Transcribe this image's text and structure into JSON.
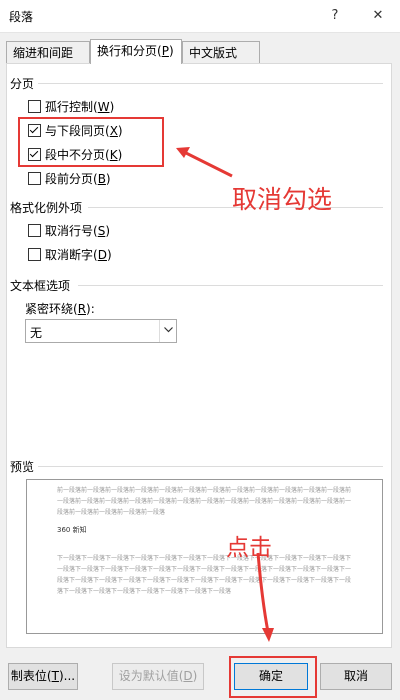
{
  "window": {
    "title": "段落",
    "help": "?",
    "close": "✕"
  },
  "tabs": [
    {
      "label": "缩进和间距(I)",
      "hotkey": "I",
      "prefix": "缩进和间距(",
      "suffix": ")"
    },
    {
      "label": "换行和分页(P)",
      "prefix": "换行和分页(",
      "hotkey": "P",
      "suffix": ")"
    },
    {
      "label": "中文版式(H)",
      "prefix": "中文版式(",
      "hotkey": "H",
      "suffix": ")"
    }
  ],
  "pagination": {
    "title": "分页",
    "items": [
      {
        "text": "孤行控制(",
        "hotkey": "W",
        "end": ")",
        "checked": false
      },
      {
        "text": "与下段同页(",
        "hotkey": "X",
        "end": ")",
        "checked": true
      },
      {
        "text": "段中不分页(",
        "hotkey": "K",
        "end": ")",
        "checked": true
      },
      {
        "text": "段前分页(",
        "hotkey": "B",
        "end": ")",
        "checked": false
      }
    ]
  },
  "exceptions": {
    "title": "格式化例外项",
    "items": [
      {
        "text": "取消行号(",
        "hotkey": "S",
        "end": ")",
        "checked": false
      },
      {
        "text": "取消断字(",
        "hotkey": "D",
        "end": ")",
        "checked": false
      }
    ]
  },
  "textbox": {
    "title": "文本框选项",
    "wrap_label_pre": "紧密环绕(",
    "wrap_hotkey": "R",
    "wrap_label_post": "):",
    "wrap_value": "无"
  },
  "preview": {
    "title": "预览",
    "prev_text": "前一段落前一段落前一段落前一段落前一段落前一段落前一段落前一段落前一段落前一段落前一段落前一段落前一段落前一段落前一段落前一段落前一段落前一段落前一段落前一段落前一段落前一段落前一段落前一段落前一段落前一段落前一段落前一段落前一段落",
    "sample": "360 新知",
    "next_text": "下一段落下一段落下一段落下一段落下一段落下一段落下一段落下一段落下一段落下一段落下一段落下一段落下一段落下一段落下一段落下一段落下一段落下一段落下一段落下一段落下一段落下一段落下一段落下一段落下一段落下一段落下一段落下一段落下一段落下一段落下一段落下一段落下一段落下一段落下一段落下一段落下一段落下一段落下一段落下一段落下一段落下一段落下一段落下一段落"
  },
  "buttons": {
    "tabs_pre": "制表位(",
    "tabs_hotkey": "T",
    "tabs_post": ")...",
    "default_pre": "设为默认值(",
    "default_hotkey": "D",
    "default_post": ")",
    "ok": "确定",
    "cancel": "取消"
  },
  "annotations": {
    "uncheck": "取消勾选",
    "click": "点击",
    "color": "#e53935"
  }
}
